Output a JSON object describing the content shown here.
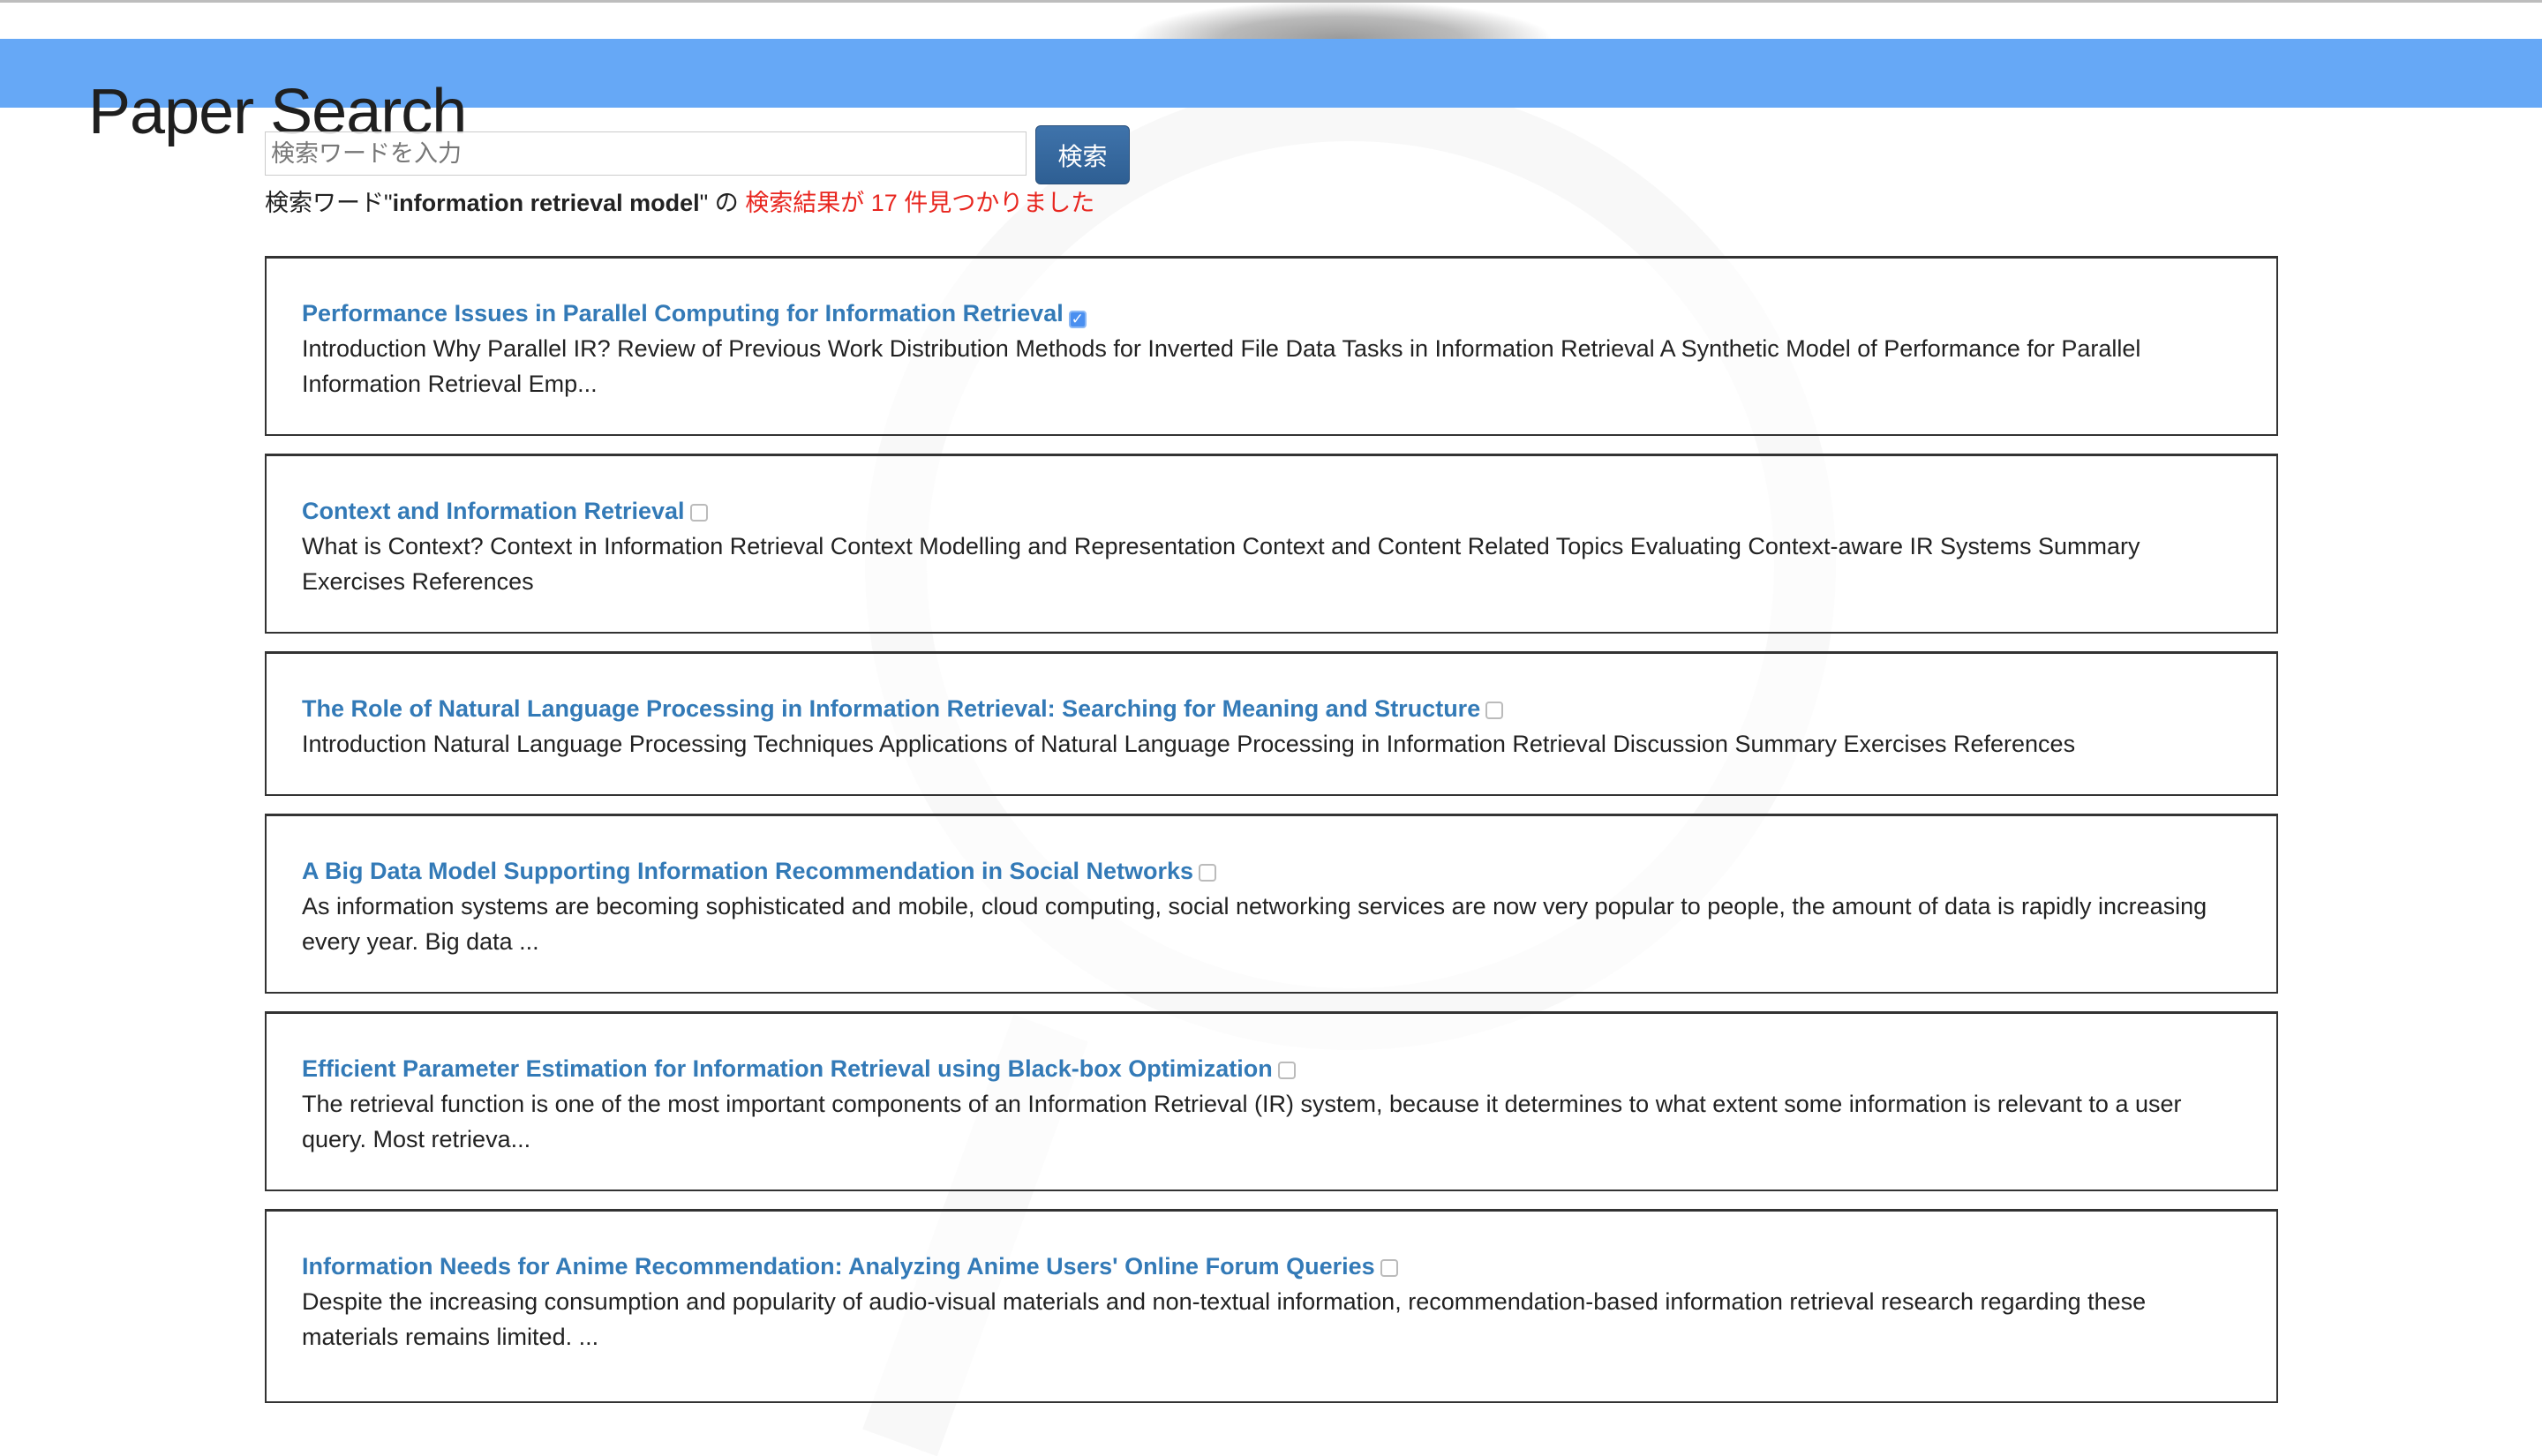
{
  "header": {
    "title": "Paper Search"
  },
  "search": {
    "placeholder": "検索ワードを入力",
    "value": "",
    "button_label": "検索"
  },
  "result_summary": {
    "prefix": "検索ワード\"",
    "query": "information retrieval model",
    "suffix": "\" の ",
    "count_text": "検索結果が 17 件見つかりました"
  },
  "results": [
    {
      "title": "Performance Issues in Parallel Computing for Information Retrieval",
      "checked": true,
      "snippet": "Introduction Why Parallel IR? Review of Previous Work Distribution Methods for Inverted File Data Tasks in Information Retrieval A Synthetic Model of Performance for Parallel Information Retrieval Emp..."
    },
    {
      "title": "Context and Information Retrieval",
      "checked": false,
      "snippet": "What is Context? Context in Information Retrieval Context Modelling and Representation Context and Content Related Topics Evaluating Context-aware IR Systems Summary Exercises References"
    },
    {
      "title": "The Role of Natural Language Processing in Information Retrieval: Searching for Meaning and Structure",
      "checked": false,
      "snippet": "Introduction Natural Language Processing Techniques Applications of Natural Language Processing in Information Retrieval Discussion Summary Exercises References"
    },
    {
      "title": "A Big Data Model Supporting Information Recommendation in Social Networks",
      "checked": false,
      "snippet": "As information systems are becoming sophisticated and mobile, cloud computing, social networking services are now very popular to people, the amount of data is rapidly increasing every year. Big data ..."
    },
    {
      "title": "Efficient Parameter Estimation for Information Retrieval using Black-box Optimization",
      "checked": false,
      "snippet": "The retrieval function is one of the most important components of an Information Retrieval (IR) system, because it determines to what extent some information is relevant to a user query. Most retrieva..."
    },
    {
      "title": "Information Needs for Anime Recommendation: Analyzing Anime Users' Online Forum Queries",
      "checked": false,
      "snippet": "Despite the increasing consumption and popularity of audio-visual materials and non-textual information, recommendation-based information retrieval research regarding these materials remains limited. ..."
    }
  ]
}
